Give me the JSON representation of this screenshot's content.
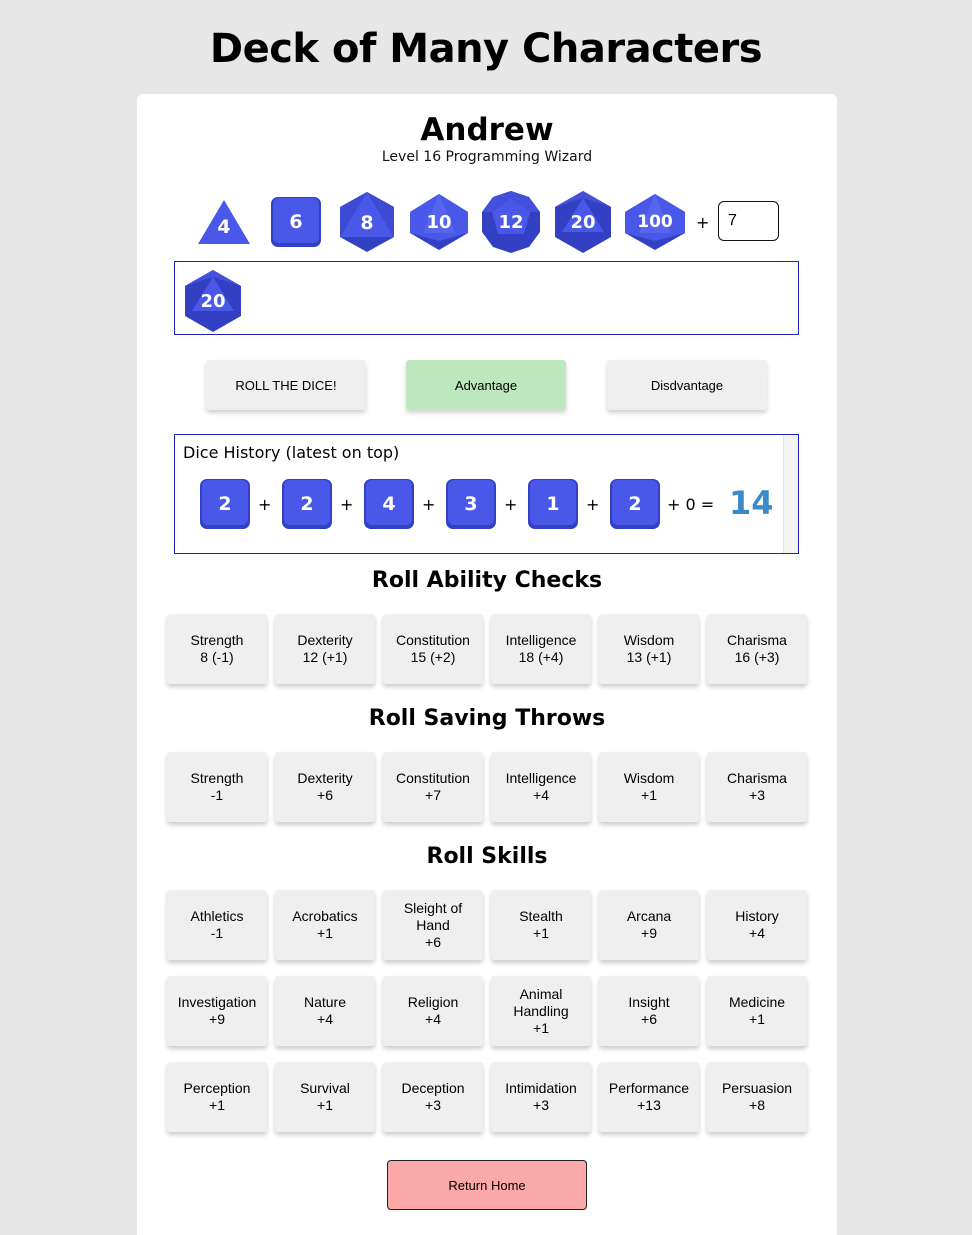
{
  "app_title": "Deck of Many Characters",
  "character": {
    "name": "Andrew",
    "subtitle": "Level 16 Programming Wizard"
  },
  "dice_selector": {
    "dice": [
      {
        "label": "4",
        "icon": "d4-icon"
      },
      {
        "label": "6",
        "icon": "d6-icon"
      },
      {
        "label": "8",
        "icon": "d8-icon"
      },
      {
        "label": "10",
        "icon": "d10-icon"
      },
      {
        "label": "12",
        "icon": "d12-icon"
      },
      {
        "label": "20",
        "icon": "d20-icon"
      },
      {
        "label": "100",
        "icon": "d100-icon"
      }
    ],
    "plus": "+",
    "modifier_value": "7"
  },
  "tray": {
    "dice": [
      {
        "label": "20",
        "icon": "d20-icon"
      }
    ]
  },
  "buttons": {
    "roll": "ROLL THE DICE!",
    "advantage": "Advantage",
    "disadvantage": "Disdvantage",
    "return_home": "Return Home"
  },
  "history": {
    "title": "Dice History (latest on top)",
    "entries": [
      {
        "rolls": [
          "2",
          "2",
          "4",
          "3",
          "1",
          "2"
        ],
        "separator": "+",
        "modifier_text": "+ 0 =",
        "total": "14"
      }
    ]
  },
  "ability_checks": {
    "title": "Roll Ability Checks",
    "items": [
      {
        "name": "Strength",
        "value": "8 (-1)"
      },
      {
        "name": "Dexterity",
        "value": "12 (+1)"
      },
      {
        "name": "Constitution",
        "value": "15 (+2)"
      },
      {
        "name": "Intelligence",
        "value": "18 (+4)"
      },
      {
        "name": "Wisdom",
        "value": "13 (+1)"
      },
      {
        "name": "Charisma",
        "value": "16 (+3)"
      }
    ]
  },
  "saving_throws": {
    "title": "Roll Saving Throws",
    "items": [
      {
        "name": "Strength",
        "value": "-1"
      },
      {
        "name": "Dexterity",
        "value": "+6"
      },
      {
        "name": "Constitution",
        "value": "+7"
      },
      {
        "name": "Intelligence",
        "value": "+4"
      },
      {
        "name": "Wisdom",
        "value": "+1"
      },
      {
        "name": "Charisma",
        "value": "+3"
      }
    ]
  },
  "skills": {
    "title": "Roll Skills",
    "items": [
      {
        "name": "Athletics",
        "value": "-1"
      },
      {
        "name": "Acrobatics",
        "value": "+1"
      },
      {
        "name": "Sleight of Hand",
        "value": "+6"
      },
      {
        "name": "Stealth",
        "value": "+1"
      },
      {
        "name": "Arcana",
        "value": "+9"
      },
      {
        "name": "History",
        "value": "+4"
      },
      {
        "name": "Investigation",
        "value": "+9"
      },
      {
        "name": "Nature",
        "value": "+4"
      },
      {
        "name": "Religion",
        "value": "+4"
      },
      {
        "name": "Animal Handling",
        "value": "+1"
      },
      {
        "name": "Insight",
        "value": "+6"
      },
      {
        "name": "Medicine",
        "value": "+1"
      },
      {
        "name": "Perception",
        "value": "+1"
      },
      {
        "name": "Survival",
        "value": "+1"
      },
      {
        "name": "Deception",
        "value": "+3"
      },
      {
        "name": "Intimidation",
        "value": "+3"
      },
      {
        "name": "Performance",
        "value": "+13"
      },
      {
        "name": "Persuasion",
        "value": "+8"
      }
    ]
  },
  "colors": {
    "die_main": "#4a58ea",
    "die_dark": "#3340c4",
    "die_light": "#6272f2",
    "advantage_active": "#bde8bd",
    "button_gray": "#efefef",
    "return_home": "#fba8a8",
    "total_text": "#3b8bc8",
    "tray_border": "#2222bb"
  }
}
